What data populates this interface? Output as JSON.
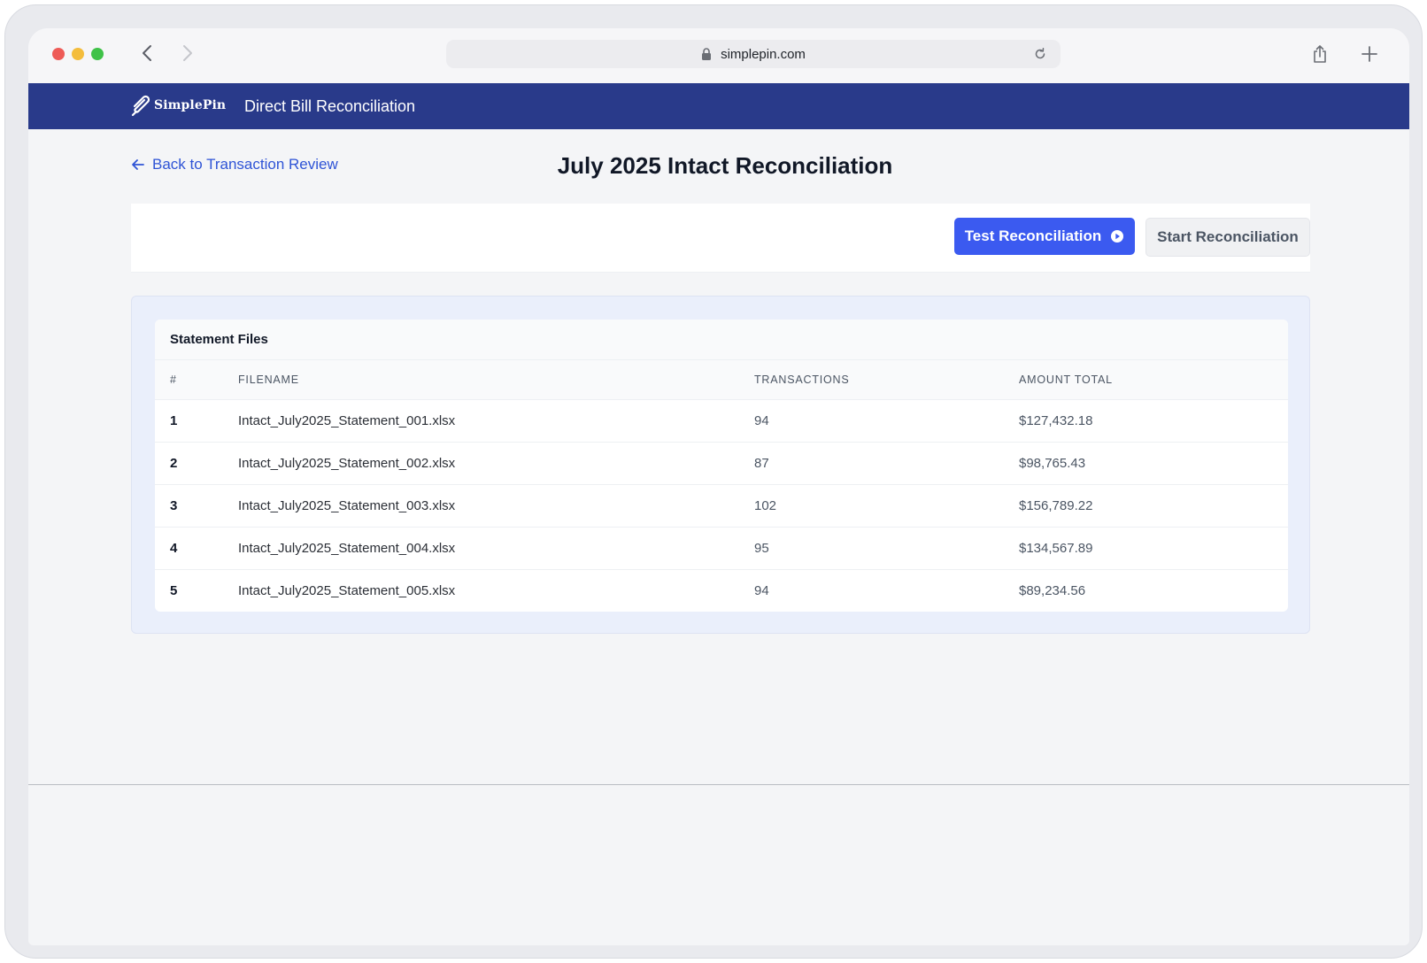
{
  "browser": {
    "url": "simplepin.com"
  },
  "header": {
    "logo_text": "SimplePin",
    "app_title": "Direct Bill Reconciliation"
  },
  "page": {
    "back_link": "Back to Transaction Review",
    "title": "July 2025 Intact Reconciliation"
  },
  "toolbar": {
    "test_button": "Test Reconciliation",
    "start_button": "Start Reconciliation"
  },
  "statement_files": {
    "title": "Statement Files",
    "columns": [
      "#",
      "FILENAME",
      "TRANSACTIONS",
      "AMOUNT TOTAL"
    ],
    "rows": [
      {
        "num": "1",
        "filename": "Intact_July2025_Statement_001.xlsx",
        "transactions": "94",
        "amount": "$127,432.18"
      },
      {
        "num": "2",
        "filename": "Intact_July2025_Statement_002.xlsx",
        "transactions": "87",
        "amount": "$98,765.43"
      },
      {
        "num": "3",
        "filename": "Intact_July2025_Statement_003.xlsx",
        "transactions": "102",
        "amount": "$156,789.22"
      },
      {
        "num": "4",
        "filename": "Intact_July2025_Statement_004.xlsx",
        "transactions": "95",
        "amount": "$134,567.89"
      },
      {
        "num": "5",
        "filename": "Intact_July2025_Statement_005.xlsx",
        "transactions": "94",
        "amount": "$89,234.56"
      }
    ]
  },
  "colors": {
    "header_bg": "#293a8a",
    "primary": "#3b5af0",
    "link": "#2f54d6"
  },
  "icons": {
    "back": "arrow-left-icon",
    "play": "play-circle-icon",
    "lock": "lock-icon",
    "reload": "reload-icon",
    "share": "share-icon",
    "new_tab": "plus-icon"
  }
}
